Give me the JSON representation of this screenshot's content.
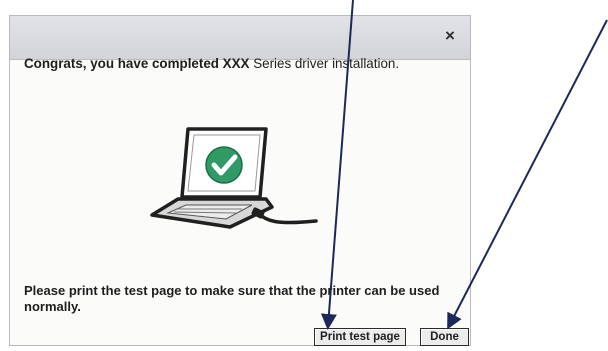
{
  "dialog": {
    "close_label": "×",
    "message_bold": "Congrats, you have completed XXX",
    "message_rest": " Series driver installation.",
    "instructions": "Please print the test page to make sure that the printer can be used normally.",
    "buttons": {
      "print_test_page": "Print test page",
      "done": "Done"
    }
  },
  "illustration": {
    "icon": "laptop-checkmark",
    "check_color": "#2f9a63"
  },
  "annotations": {
    "arrow_color": "#1b2a5a"
  }
}
